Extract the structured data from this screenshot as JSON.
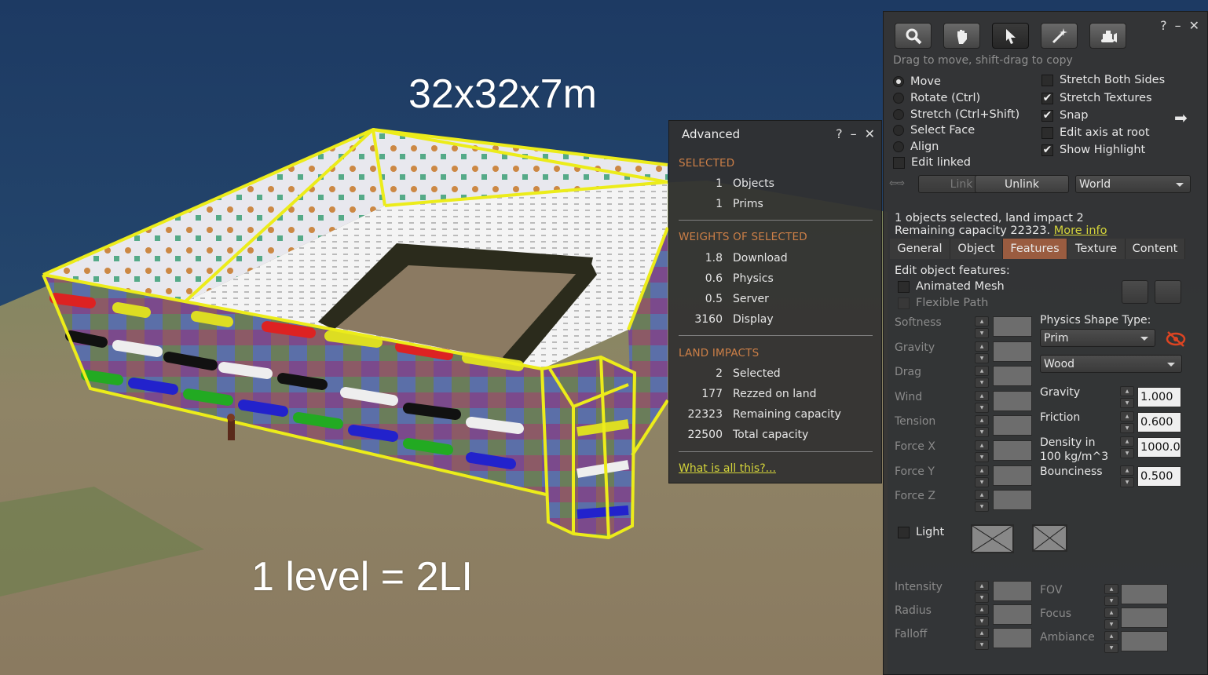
{
  "scene": {
    "caption_top": "32x32x7m",
    "caption_bottom": "1 level = 2LI"
  },
  "advanced": {
    "title": "Advanced",
    "selected": {
      "heading": "SELECTED",
      "rows": [
        {
          "value": "1",
          "label": "Objects"
        },
        {
          "value": "1",
          "label": "Prims"
        }
      ]
    },
    "weights": {
      "heading": "WEIGHTS OF SELECTED",
      "rows": [
        {
          "value": "1.8",
          "label": "Download"
        },
        {
          "value": "0.6",
          "label": "Physics"
        },
        {
          "value": "0.5",
          "label": "Server"
        },
        {
          "value": "3160",
          "label": "Display"
        }
      ]
    },
    "land": {
      "heading": "LAND IMPACTS",
      "rows": [
        {
          "value": "2",
          "label": "Selected"
        },
        {
          "value": "177",
          "label": "Rezzed on land"
        },
        {
          "value": "22323",
          "label": "Remaining capacity"
        },
        {
          "value": "22500",
          "label": "Total capacity"
        }
      ]
    },
    "help_link": "What is all this?..."
  },
  "tools": {
    "hint": "Drag to move, shift-drag to copy",
    "modes": [
      "Move",
      "Rotate (Ctrl)",
      "Stretch (Ctrl+Shift)",
      "Select Face",
      "Align"
    ],
    "edit_linked": "Edit linked",
    "options": [
      "Stretch Both Sides",
      "Stretch Textures",
      "Snap",
      "Edit axis at root",
      "Show Highlight"
    ],
    "link_label": "Link",
    "unlink_label": "Unlink",
    "world_label": "World",
    "status_line1": "1 objects selected, land impact 2",
    "status_line2": "Remaining capacity 22323.",
    "more_info": "More info",
    "tabs": [
      "General",
      "Object",
      "Features",
      "Texture",
      "Content"
    ],
    "active_tab": "Features",
    "features": {
      "heading": "Edit object features:",
      "animated_mesh": "Animated Mesh",
      "flexible_path": "Flexible Path",
      "flex_fields": [
        "Softness",
        "Gravity",
        "Drag",
        "Wind",
        "Tension",
        "Force X",
        "Force Y",
        "Force Z"
      ],
      "physics_shape_label": "Physics Shape Type:",
      "physics_shape_value": "Prim",
      "material_value": "Wood",
      "gravity_label": "Gravity",
      "gravity_value": "1.000",
      "friction_label": "Friction",
      "friction_value": "0.600",
      "density_label": "Density in",
      "density_label2": "100 kg/m^3",
      "density_value": "1000.0",
      "bounciness_label": "Bounciness",
      "bounciness_value": "0.500",
      "light_label": "Light",
      "light_fields_left": [
        "Intensity",
        "Radius",
        "Falloff"
      ],
      "light_fields_right": [
        "FOV",
        "Focus",
        "Ambiance"
      ]
    }
  }
}
